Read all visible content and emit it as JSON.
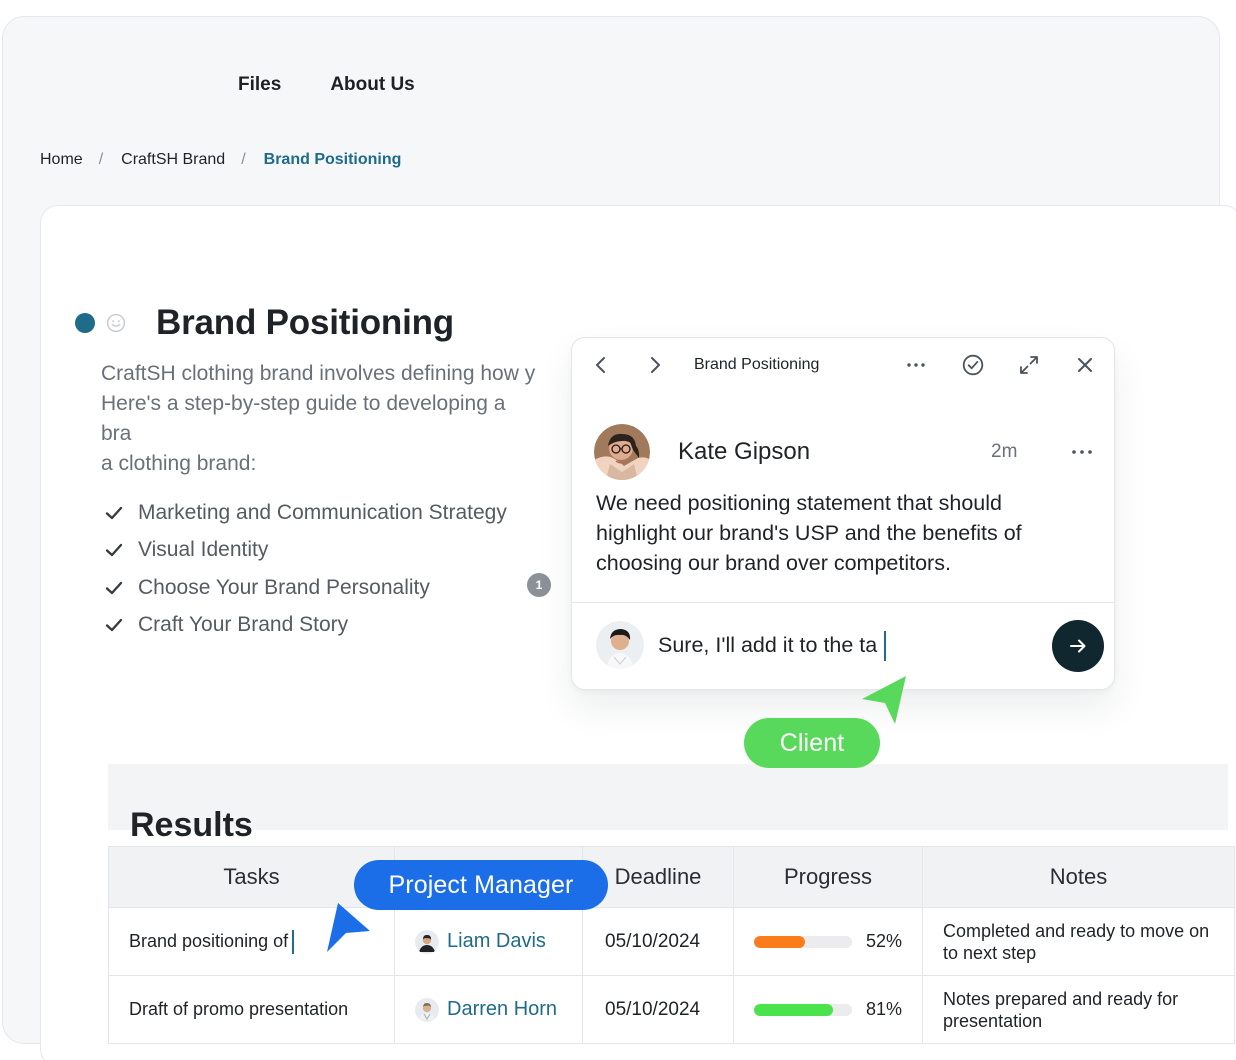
{
  "nav": {
    "items": [
      "Files",
      "About Us"
    ]
  },
  "breadcrumb": {
    "items": [
      "Home",
      "CraftSH Brand",
      "Brand Positioning"
    ],
    "separator": "/"
  },
  "page": {
    "title": "Brand Positioning",
    "status_color": "#1f6b8a",
    "description_lines": [
      "CraftSH clothing brand involves defining how y",
      "Here's a step-by-step guide to developing a bra",
      "a clothing brand:"
    ],
    "checklist": [
      "Marketing and Communication Strategy",
      "Visual Identity",
      "Choose Your Brand Personality",
      "Craft Your Brand Story"
    ],
    "comment_count": "1"
  },
  "results": {
    "title": "Results",
    "columns": [
      "Tasks",
      "",
      "Deadline",
      "Progress",
      "Notes"
    ],
    "rows": [
      {
        "task": "Brand positioning of",
        "assignee": "Liam Davis",
        "deadline": "05/10/2024",
        "progress": 52,
        "progress_label": "52%",
        "progress_color": "#fb7c1a",
        "notes": "Completed and ready to move on to next step"
      },
      {
        "task": "Draft of promo presentation",
        "assignee": "Darren Horn",
        "deadline": "05/10/2024",
        "progress": 81,
        "progress_label": "81%",
        "progress_color": "#4ae34b",
        "notes": "Notes prepared and ready for presentation"
      }
    ]
  },
  "popover": {
    "title": "Brand Positioning",
    "author": "Kate Gipson",
    "time": "2m",
    "message": "We need positioning statement that should highlight our brand's USP and the benefits of choosing our brand over competitors.",
    "reply_value": "Sure, I'll add it to the ta"
  },
  "cursors": {
    "client_label": "Client",
    "client_color": "#59d95b",
    "manager_label": "Project Manager",
    "manager_color": "#1b6ee8"
  },
  "icons": {
    "back": "chevron-left-icon",
    "forward": "chevron-right-icon",
    "more": "more-horizontal-icon",
    "resolve": "check-circle-icon",
    "expand": "expand-icon",
    "close": "close-icon",
    "send": "arrow-right-icon",
    "check": "check-icon",
    "emoji": "smiley-icon"
  }
}
